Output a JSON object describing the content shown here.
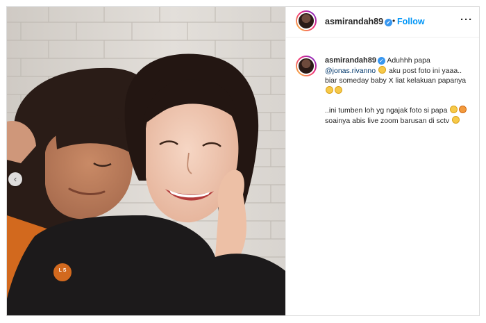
{
  "post": {
    "username": "asmirandah89",
    "follow_label": "Follow",
    "dot": "•",
    "more_label": "···"
  },
  "caption": {
    "username": "asmirandah89",
    "line1_text": "Aduhhh papa",
    "mention": "@jonas.rivanno",
    "line2_text": "aku post foto ini yaaa.. biar someday baby X liat kelakuan papanya",
    "para2_a": "..ini tumben loh yg ngajak foto si papa",
    "para2_b": "soainya abis live zoom barusan di sctv"
  },
  "photo": {
    "badge_text": "L S",
    "carousel_prev": "‹"
  },
  "colors": {
    "follow": "#0095f6",
    "verified": "#3897f0",
    "mention": "#00376b"
  }
}
